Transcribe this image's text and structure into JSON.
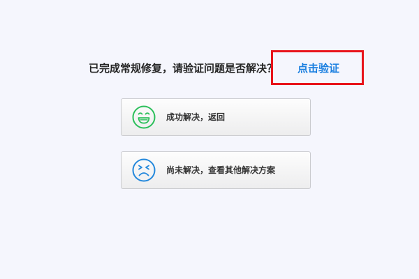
{
  "prompt": {
    "question": "已完成常规修复，请验证问题是否解决？",
    "verify_link": "点击验证"
  },
  "options": {
    "solved": {
      "label": "成功解决，返回",
      "icon": "smile-face-icon",
      "icon_color": "#2bbf5a"
    },
    "unsolved": {
      "label": "尚未解决，查看其他解决方案",
      "icon": "sad-face-icon",
      "icon_color": "#2388dc"
    }
  },
  "colors": {
    "background": "#f5f6fd",
    "link": "#1a7fe0",
    "highlight": "#e8141b"
  }
}
